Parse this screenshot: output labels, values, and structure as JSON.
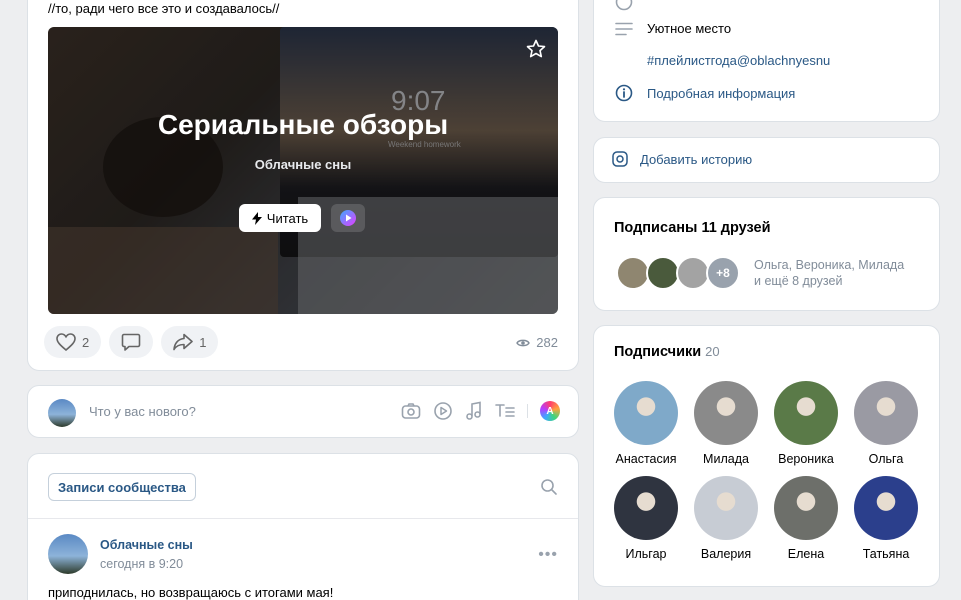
{
  "post": {
    "text": "//то, ради чего все это и создавалось//",
    "cover_title": "Сериальные обзоры",
    "cover_subtitle": "Облачные сны",
    "clock": "9:07",
    "clock_sub": "Weekend homework",
    "read_label": "Читать",
    "likes": "2",
    "reposts": "1",
    "views": "282"
  },
  "compose": {
    "placeholder": "Что у вас нового?",
    "attach_badge": "A"
  },
  "feed": {
    "tab_label": "Записи сообщества",
    "author": "Облачные сны",
    "time": "сегодня в 9:20",
    "text": "приподнилась, но возвращаюсь с итогами мая!"
  },
  "info": {
    "place": "Уютное место",
    "tag": "#плейлистгода@oblachnyesnu",
    "details": "Подробная информация"
  },
  "story": {
    "label": "Добавить историю"
  },
  "friends": {
    "title": "Подписаны 11 друзей",
    "more_badge": "+8",
    "names_line1": "Ольга, Вероника, Милада",
    "names_line2": "и ещё 8 друзей"
  },
  "subscribers": {
    "title": "Подписчики",
    "count": "20",
    "people": [
      {
        "name": "Анастасия",
        "color": "#7fa9c9"
      },
      {
        "name": "Милада",
        "color": "#8a8a8a"
      },
      {
        "name": "Вероника",
        "color": "#5a7a48"
      },
      {
        "name": "Ольга",
        "color": "#9a9aa3"
      },
      {
        "name": "Ильгар",
        "color": "#2f3440"
      },
      {
        "name": "Валерия",
        "color": "#c7ccd4"
      },
      {
        "name": "Елена",
        "color": "#6d6f6a"
      },
      {
        "name": "Татьяна",
        "color": "#2b3f8c"
      }
    ]
  },
  "colors": {
    "accent": "#2a5885",
    "muted": "#818c99",
    "bg": "#edeef0"
  }
}
